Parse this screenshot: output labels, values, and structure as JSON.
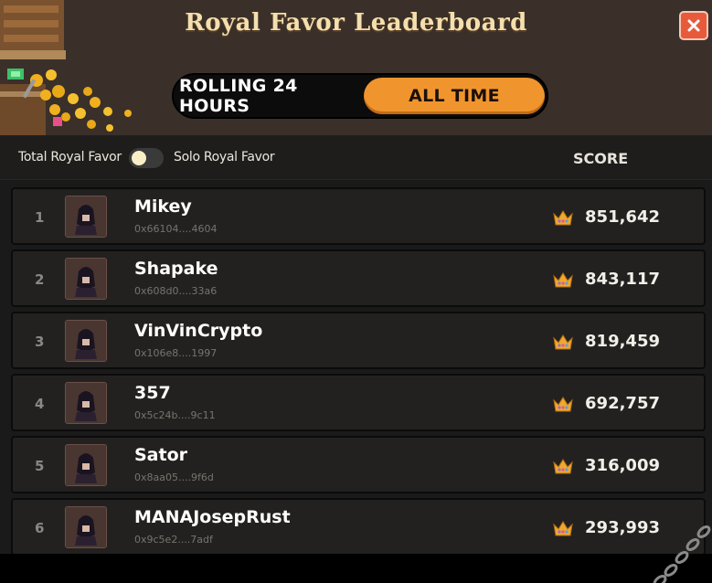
{
  "header": {
    "title": "Royal Favor Leaderboard",
    "close_icon": "close-icon"
  },
  "tabs": {
    "rolling": "ROLLING 24 HOURS",
    "all_time": "ALL TIME",
    "active": "all_time"
  },
  "filters": {
    "total_label": "Total Royal Favor",
    "solo_label": "Solo Royal Favor",
    "score_header": "SCORE"
  },
  "rows": [
    {
      "rank": "1",
      "name": "Mikey",
      "address": "0x66104....4604",
      "score": "851,642"
    },
    {
      "rank": "2",
      "name": "Shapake",
      "address": "0x608d0....33a6",
      "score": "843,117"
    },
    {
      "rank": "3",
      "name": "VinVinCrypto",
      "address": "0x106e8....1997",
      "score": "819,459"
    },
    {
      "rank": "4",
      "name": "357",
      "address": "0x5c24b....9c11",
      "score": "692,757"
    },
    {
      "rank": "5",
      "name": "Sator",
      "address": "0x8aa05....9f6d",
      "score": "316,009"
    },
    {
      "rank": "6",
      "name": "MANAJosepRust",
      "address": "0x9c5e2....7adf",
      "score": "293,993"
    }
  ],
  "colors": {
    "accent": "#f0952e",
    "close": "#e85a3c",
    "title": "#f4dfae"
  }
}
